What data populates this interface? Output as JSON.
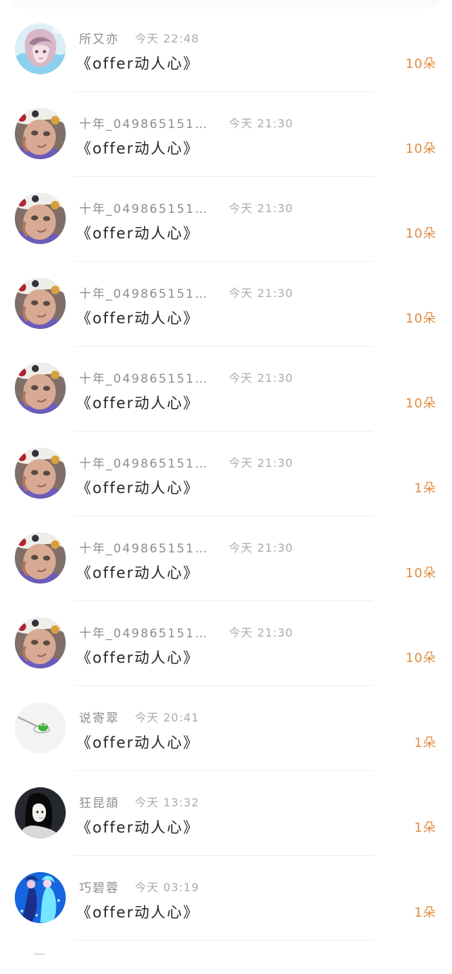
{
  "list": {
    "items": [
      {
        "avatar_name": "anime-girl-avatar",
        "name": "所又亦",
        "time": "今天 22:48",
        "title": "《offer动人心》",
        "amount": "10朵"
      },
      {
        "avatar_name": "baby-avatar",
        "name": "十年_0498651519…",
        "time": "今天 21:30",
        "title": "《offer动人心》",
        "amount": "10朵"
      },
      {
        "avatar_name": "baby-avatar",
        "name": "十年_0498651519…",
        "time": "今天 21:30",
        "title": "《offer动人心》",
        "amount": "10朵"
      },
      {
        "avatar_name": "baby-avatar",
        "name": "十年_0498651519…",
        "time": "今天 21:30",
        "title": "《offer动人心》",
        "amount": "10朵"
      },
      {
        "avatar_name": "baby-avatar",
        "name": "十年_0498651519…",
        "time": "今天 21:30",
        "title": "《offer动人心》",
        "amount": "10朵"
      },
      {
        "avatar_name": "baby-avatar",
        "name": "十年_0498651519…",
        "time": "今天 21:30",
        "title": "《offer动人心》",
        "amount": "1朵"
      },
      {
        "avatar_name": "baby-avatar",
        "name": "十年_0498651519…",
        "time": "今天 21:30",
        "title": "《offer动人心》",
        "amount": "10朵"
      },
      {
        "avatar_name": "baby-avatar",
        "name": "十年_0498651519…",
        "time": "今天 21:30",
        "title": "《offer动人心》",
        "amount": "10朵"
      },
      {
        "avatar_name": "frog-spoon-avatar",
        "name": "说寄翠",
        "time": "今天 20:41",
        "title": "《offer动人心》",
        "amount": "1朵"
      },
      {
        "avatar_name": "woman-portrait-avatar",
        "name": "狂昆頡",
        "time": "今天 13:32",
        "title": "《offer动人心》",
        "amount": "1朵"
      },
      {
        "avatar_name": "blue-characters-avatar",
        "name": "巧碧蓉",
        "time": "今天 03:19",
        "title": "《offer动人心》",
        "amount": "1朵"
      }
    ]
  },
  "colors": {
    "background": "#ffffff",
    "name": "#8e8e8e",
    "time": "#acacac",
    "title": "#262626",
    "amount": "#df8c3f",
    "divider": "#eeeeee"
  }
}
